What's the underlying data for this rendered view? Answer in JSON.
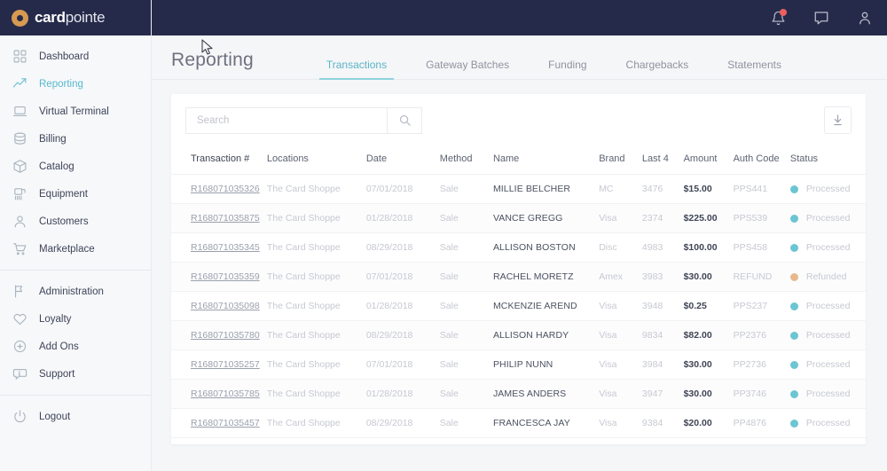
{
  "brand": {
    "name_bold": "card",
    "name_light": "pointe",
    "logo_icon": "target-dot-icon"
  },
  "topbar": {
    "notifications_icon": "bell-icon",
    "messages_icon": "chat-bubble-icon",
    "account_icon": "user-icon",
    "has_notification": true,
    "notification_color": "#ec5f5f"
  },
  "sidebar": {
    "groups": [
      {
        "items": [
          {
            "label": "Dashboard",
            "icon": "grid-squares-icon",
            "active": false
          },
          {
            "label": "Reporting",
            "icon": "trend-arrow-icon",
            "active": true
          },
          {
            "label": "Virtual Terminal",
            "icon": "laptop-icon",
            "active": false
          },
          {
            "label": "Billing",
            "icon": "database-stack-icon",
            "active": false
          },
          {
            "label": "Catalog",
            "icon": "cube-icon",
            "active": false
          },
          {
            "label": "Equipment",
            "icon": "card-reader-icon",
            "active": false
          },
          {
            "label": "Customers",
            "icon": "person-icon",
            "active": false
          },
          {
            "label": "Marketplace",
            "icon": "shopping-cart-icon",
            "active": false
          }
        ]
      },
      {
        "items": [
          {
            "label": "Administration",
            "icon": "flag-icon",
            "active": false
          },
          {
            "label": "Loyalty",
            "icon": "heart-icon",
            "active": false
          },
          {
            "label": "Add Ons",
            "icon": "plus-circle-icon",
            "active": false
          },
          {
            "label": "Support",
            "icon": "chat-info-icon",
            "active": false
          }
        ]
      },
      {
        "items": [
          {
            "label": "Logout",
            "icon": "power-icon",
            "active": false
          }
        ]
      }
    ]
  },
  "page": {
    "title": "Reporting",
    "tabs": [
      {
        "label": "Transactions",
        "active": true
      },
      {
        "label": "Gateway Batches",
        "active": false
      },
      {
        "label": "Funding",
        "active": false
      },
      {
        "label": "Chargebacks",
        "active": false
      },
      {
        "label": "Statements",
        "active": false
      }
    ],
    "active_tab_color": "#5ab4c6"
  },
  "toolbar": {
    "search_placeholder": "Search",
    "search_value": "",
    "search_icon": "magnifier-icon",
    "download_icon": "download-arrow-icon"
  },
  "table": {
    "columns": [
      "Transaction #",
      "Locations",
      "Date",
      "Method",
      "Name",
      "Brand",
      "Last 4",
      "Amount",
      "Auth Code",
      "Status"
    ],
    "status_colors": {
      "Processed": "#6cc5d2",
      "Refunded": "#e8b98e"
    },
    "rows": [
      {
        "txn": "R168071035326",
        "location": "The Card Shoppe",
        "date": "07/01/2018",
        "method": "Sale",
        "name": "MILLIE BELCHER",
        "brand": "MC",
        "last4": "3476",
        "amount": "$15.00",
        "auth": "PPS441",
        "status": "Processed"
      },
      {
        "txn": "R168071035875",
        "location": "The Card Shoppe",
        "date": "01/28/2018",
        "method": "Sale",
        "name": "VANCE GREGG",
        "brand": "Visa",
        "last4": "2374",
        "amount": "$225.00",
        "auth": "PPS539",
        "status": "Processed"
      },
      {
        "txn": "R168071035345",
        "location": "The Card Shoppe",
        "date": "08/29/2018",
        "method": "Sale",
        "name": "ALLISON BOSTON",
        "brand": "Disc",
        "last4": "4983",
        "amount": "$100.00",
        "auth": "PPS458",
        "status": "Processed"
      },
      {
        "txn": "R168071035359",
        "location": "The Card Shoppe",
        "date": "07/01/2018",
        "method": "Sale",
        "name": "RACHEL MORETZ",
        "brand": "Amex",
        "last4": "3983",
        "amount": "$30.00",
        "auth": "REFUND",
        "status": "Refunded"
      },
      {
        "txn": "R168071035098",
        "location": "The Card Shoppe",
        "date": "01/28/2018",
        "method": "Sale",
        "name": "MCKENZIE AREND",
        "brand": "Visa",
        "last4": "3948",
        "amount": "$0.25",
        "auth": "PPS237",
        "status": "Processed"
      },
      {
        "txn": "R168071035780",
        "location": "The Card Shoppe",
        "date": "08/29/2018",
        "method": "Sale",
        "name": "ALLISON HARDY",
        "brand": "Visa",
        "last4": "9834",
        "amount": "$82.00",
        "auth": "PP2376",
        "status": "Processed"
      },
      {
        "txn": "R168071035257",
        "location": "The Card Shoppe",
        "date": "07/01/2018",
        "method": "Sale",
        "name": "PHILIP NUNN",
        "brand": "Visa",
        "last4": "3984",
        "amount": "$30.00",
        "auth": "PP2736",
        "status": "Processed"
      },
      {
        "txn": "R168071035785",
        "location": "The Card Shoppe",
        "date": "01/28/2018",
        "method": "Sale",
        "name": "JAMES ANDERS",
        "brand": "Visa",
        "last4": "3947",
        "amount": "$30.00",
        "auth": "PP3746",
        "status": "Processed"
      },
      {
        "txn": "R168071035457",
        "location": "The Card Shoppe",
        "date": "08/29/2018",
        "method": "Sale",
        "name": "FRANCESCA JAY",
        "brand": "Visa",
        "last4": "9384",
        "amount": "$20.00",
        "auth": "PP4876",
        "status": "Processed"
      }
    ]
  }
}
